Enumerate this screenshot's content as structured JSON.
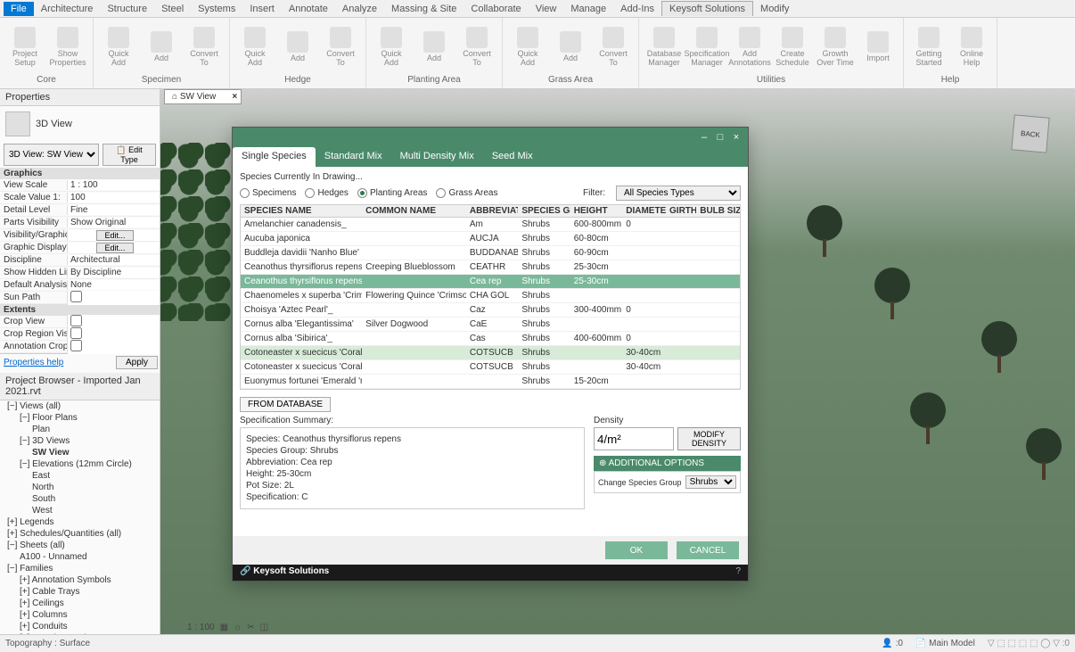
{
  "menubar": [
    "File",
    "Architecture",
    "Structure",
    "Steel",
    "Systems",
    "Insert",
    "Annotate",
    "Analyze",
    "Massing & Site",
    "Collaborate",
    "View",
    "Manage",
    "Add-Ins",
    "Keysoft Solutions",
    "Modify"
  ],
  "menubar_active": 13,
  "ribbon": {
    "groups": [
      {
        "label": "Core",
        "buttons": [
          "Project Setup",
          "Show Properties"
        ]
      },
      {
        "label": "Specimen",
        "buttons": [
          "Quick Add",
          "Add",
          "Convert To"
        ]
      },
      {
        "label": "Hedge",
        "buttons": [
          "Quick Add",
          "Add",
          "Convert To"
        ]
      },
      {
        "label": "Planting Area",
        "buttons": [
          "Quick Add",
          "Add",
          "Convert To"
        ]
      },
      {
        "label": "Grass Area",
        "buttons": [
          "Quick Add",
          "Add",
          "Convert To"
        ]
      },
      {
        "label": "Utilities",
        "buttons": [
          "Database Manager",
          "Specification Manager",
          "Add Annotations",
          "Create Schedule",
          "Growth Over Time",
          "Import"
        ]
      },
      {
        "label": "Help",
        "buttons": [
          "Getting Started",
          "Online Help"
        ]
      }
    ]
  },
  "properties": {
    "title": "Properties",
    "viewType": "3D View",
    "typeSelector": "3D View: SW View",
    "editType": "Edit Type",
    "sections": {
      "Graphics": [
        {
          "k": "View Scale",
          "v": "1 : 100",
          "editable": true
        },
        {
          "k": "Scale Value    1:",
          "v": "100"
        },
        {
          "k": "Detail Level",
          "v": "Fine"
        },
        {
          "k": "Parts Visibility",
          "v": "Show Original"
        },
        {
          "k": "Visibility/Graphics ...",
          "v": "Edit...",
          "btn": true
        },
        {
          "k": "Graphic Display O...",
          "v": "Edit...",
          "btn": true
        },
        {
          "k": "Discipline",
          "v": "Architectural"
        },
        {
          "k": "Show Hidden Lines",
          "v": "By Discipline"
        },
        {
          "k": "Default Analysis Di...",
          "v": "None"
        },
        {
          "k": "Sun Path",
          "v": "",
          "check": true
        }
      ],
      "Extents": [
        {
          "k": "Crop View",
          "v": "",
          "check": true
        },
        {
          "k": "Crop Region Visible",
          "v": "",
          "check": true
        },
        {
          "k": "Annotation Crop",
          "v": "",
          "check": true
        }
      ]
    },
    "helpLink": "Properties help",
    "applyBtn": "Apply"
  },
  "browser": {
    "title": "Project Browser - Imported Jan 2021.rvt",
    "tree": [
      {
        "t": "Views (all)",
        "l": 0,
        "exp": "−"
      },
      {
        "t": "Floor Plans",
        "l": 1,
        "exp": "−"
      },
      {
        "t": "Plan",
        "l": 2
      },
      {
        "t": "3D Views",
        "l": 1,
        "exp": "−"
      },
      {
        "t": "SW View",
        "l": 2,
        "bold": true
      },
      {
        "t": "Elevations (12mm Circle)",
        "l": 1,
        "exp": "−"
      },
      {
        "t": "East",
        "l": 2
      },
      {
        "t": "North",
        "l": 2
      },
      {
        "t": "South",
        "l": 2
      },
      {
        "t": "West",
        "l": 2
      },
      {
        "t": "Legends",
        "l": 0,
        "exp": "+"
      },
      {
        "t": "Schedules/Quantities (all)",
        "l": 0,
        "exp": "+"
      },
      {
        "t": "Sheets (all)",
        "l": 0,
        "exp": "−"
      },
      {
        "t": "A100 - Unnamed",
        "l": 1
      },
      {
        "t": "Families",
        "l": 0,
        "exp": "−"
      },
      {
        "t": "Annotation Symbols",
        "l": 1,
        "exp": "+"
      },
      {
        "t": "Cable Trays",
        "l": 1,
        "exp": "+"
      },
      {
        "t": "Ceilings",
        "l": 1,
        "exp": "+"
      },
      {
        "t": "Columns",
        "l": 1,
        "exp": "+"
      },
      {
        "t": "Conduits",
        "l": 1,
        "exp": "+"
      },
      {
        "t": "Curtain Panels",
        "l": 1,
        "exp": "+"
      }
    ]
  },
  "viewTab": "SW View",
  "viewScale": "1 : 100",
  "status": {
    "left": "Topography : Surface",
    "workset": ":0",
    "model": "Main Model"
  },
  "dialog": {
    "tabs": [
      "Single Species",
      "Standard Mix",
      "Multi Density Mix",
      "Seed Mix"
    ],
    "activeTab": 0,
    "drawingLabel": "Species Currently In Drawing...",
    "radios": [
      "Specimens",
      "Hedges",
      "Planting Areas",
      "Grass Areas"
    ],
    "radioChecked": 2,
    "filterLabel": "Filter:",
    "filterValue": "All Species Types",
    "headers": [
      "SPECIES NAME",
      "COMMON NAME",
      "ABBREVIATION",
      "SPECIES GROUP",
      "HEIGHT",
      "DIAMETER",
      "GIRTH",
      "BULB SIZE"
    ],
    "rows": [
      {
        "n": "Amelanchier canadensis_",
        "c": "",
        "a": "Am",
        "g": "Shrubs",
        "h": "600-800mm",
        "d": "0"
      },
      {
        "n": "Aucuba japonica",
        "c": "",
        "a": "AUCJA",
        "g": "Shrubs",
        "h": "60-80cm",
        "d": ""
      },
      {
        "n": "Buddleja davidii 'Nanho Blue'",
        "c": "",
        "a": "BUDDANAB",
        "g": "Shrubs",
        "h": "60-90cm",
        "d": ""
      },
      {
        "n": "Ceanothus thyrsiflorus repens",
        "c": "Creeping Blueblossom",
        "a": "CEATHR",
        "g": "Shrubs",
        "h": "25-30cm",
        "d": ""
      },
      {
        "n": "Ceanothus thyrsiflorus repens",
        "c": "",
        "a": "Cea rep",
        "g": "Shrubs",
        "h": "25-30cm",
        "d": "",
        "sel": true
      },
      {
        "n": "Chaenomeles x superba 'Crimson & Gold'",
        "c": "Flowering Quince 'Crimson & Gold'",
        "a": "CHA GOL",
        "g": "Shrubs",
        "h": "",
        "d": ""
      },
      {
        "n": "Choisya 'Aztec Pearl'_",
        "c": "",
        "a": "Caz",
        "g": "Shrubs",
        "h": "300-400mm",
        "d": "0"
      },
      {
        "n": "Cornus alba 'Elegantissima'",
        "c": "Silver Dogwood",
        "a": "CaE",
        "g": "Shrubs",
        "h": "",
        "d": ""
      },
      {
        "n": "Cornus alba 'Sibirica'_",
        "c": "",
        "a": "Cas",
        "g": "Shrubs",
        "h": "400-600mm",
        "d": "0"
      },
      {
        "n": "Cotoneaster x suecicus 'Coral Beauty'",
        "c": "",
        "a": "COTSUCB",
        "g": "Shrubs",
        "h": "",
        "d": "30-40cm",
        "hover": true
      },
      {
        "n": "Cotoneaster x suecicus 'Coral Beauty'",
        "c": "",
        "a": "COTSUCB",
        "g": "Shrubs",
        "h": "",
        "d": "30-40cm"
      },
      {
        "n": "Euonymus fortunei 'Emerald 'n' Gold'",
        "c": "",
        "a": "",
        "g": "Shrubs",
        "h": "15-20cm",
        "d": ""
      }
    ],
    "fromDb": "FROM DATABASE",
    "summaryTitle": "Specification Summary:",
    "summary": [
      "Species: Ceanothus thyrsiflorus repens",
      "Species Group: Shrubs",
      "Abbreviation: Cea rep",
      "Height: 25-30cm",
      "Pot Size: 2L",
      "Specification: C"
    ],
    "densityLabel": "Density",
    "densityValue": "4/m²",
    "modifyDensity": "MODIFY DENSITY",
    "addOptHeader": "ADDITIONAL OPTIONS",
    "changeGroupLabel": "Change Species Group",
    "changeGroupValue": "Shrubs",
    "ok": "OK",
    "cancel": "CANCEL",
    "brand": "Keysoft Solutions",
    "help": "?"
  }
}
